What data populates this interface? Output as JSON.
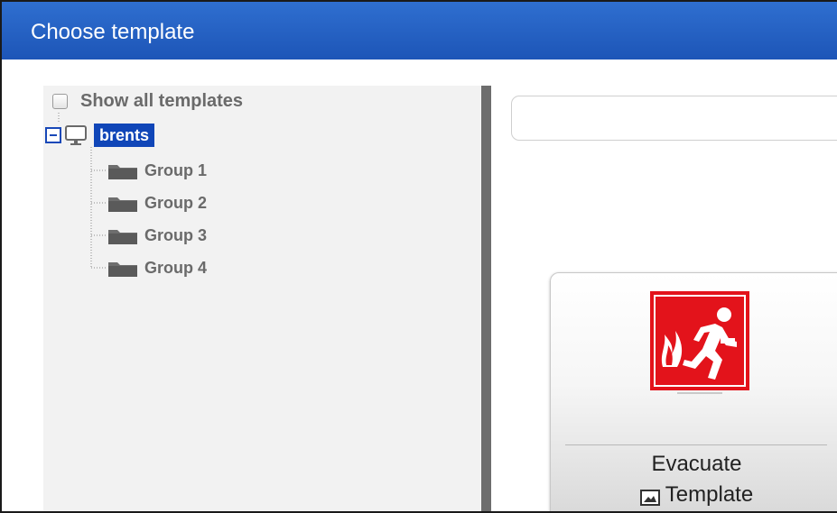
{
  "dialog": {
    "title": "Choose template"
  },
  "tree": {
    "show_all_label": "Show all templates",
    "show_all_checked": false,
    "root": {
      "label": "brents",
      "expanded": true,
      "icon": "monitor-icon"
    },
    "groups": [
      {
        "label": "Group 1",
        "icon": "folder-icon"
      },
      {
        "label": "Group 2",
        "icon": "folder-icon"
      },
      {
        "label": "Group 3",
        "icon": "folder-icon"
      },
      {
        "label": "Group 4",
        "icon": "folder-icon"
      }
    ]
  },
  "search": {
    "value": "",
    "placeholder": ""
  },
  "templates": [
    {
      "name": "Evacuate",
      "type_label": "Template",
      "thumbnail_icon": "fire-exit-icon",
      "type_icon": "image-icon",
      "colors": {
        "sign_red": "#e3131b",
        "sign_white": "#ffffff"
      }
    }
  ],
  "colors": {
    "titlebar": "#1d55b7",
    "selection": "#1046b8",
    "panel_bg": "#f2f2f2",
    "splitter": "#6d6d6d"
  }
}
